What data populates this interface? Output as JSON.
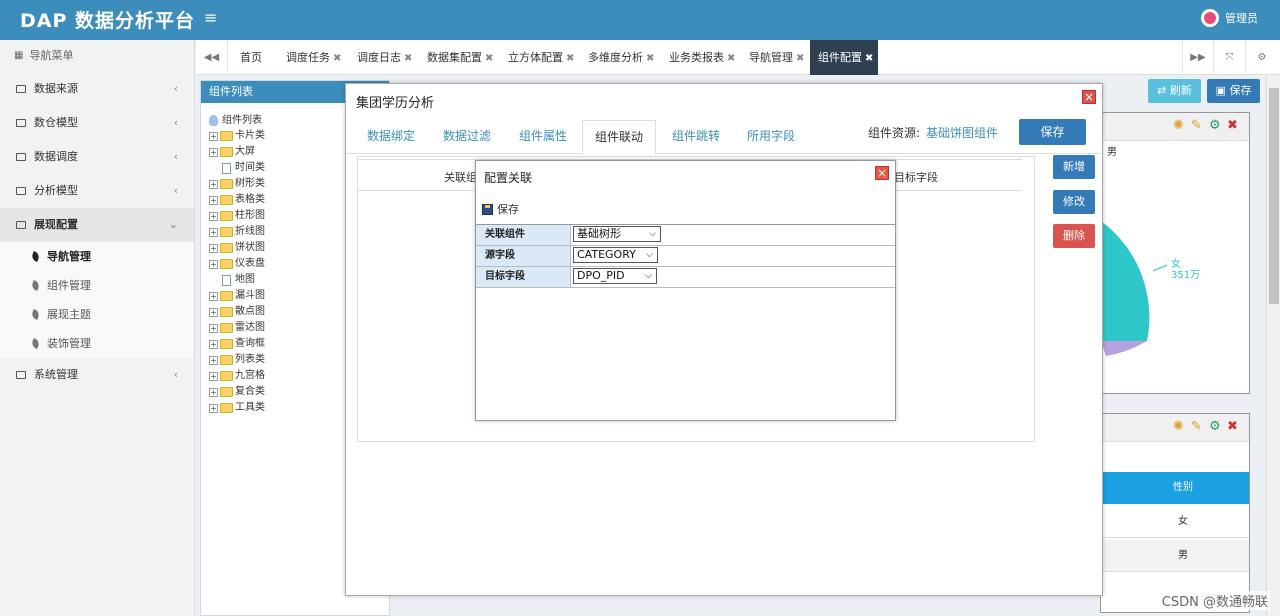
{
  "app": {
    "logo": "DAP 数据分析平台",
    "menu_toggle": "≡",
    "user": "管理员"
  },
  "sidebar": {
    "header": "导航菜单",
    "items": [
      {
        "label": "数据来源"
      },
      {
        "label": "数仓模型"
      },
      {
        "label": "数据调度"
      },
      {
        "label": "分析模型"
      },
      {
        "label": "展现配置"
      },
      {
        "label": "系统管理"
      }
    ],
    "subitems": [
      {
        "label": "导航管理"
      },
      {
        "label": "组件管理"
      },
      {
        "label": "展现主题"
      },
      {
        "label": "装饰管理"
      }
    ]
  },
  "tabs": [
    {
      "label": "首页"
    },
    {
      "label": "调度任务"
    },
    {
      "label": "调度日志"
    },
    {
      "label": "数据集配置"
    },
    {
      "label": "立方体配置"
    },
    {
      "label": "多维度分析"
    },
    {
      "label": "业务类报表"
    },
    {
      "label": "导航管理"
    },
    {
      "label": "组件配置"
    }
  ],
  "toolbar": {
    "refresh": "刷新",
    "save": "保存"
  },
  "left_panel": {
    "title": "组件列表",
    "root": "组件列表",
    "nodes": [
      {
        "label": "卡片类"
      },
      {
        "label": "大屏"
      },
      {
        "label": "时间类"
      },
      {
        "label": "树形类"
      },
      {
        "label": "表格类"
      },
      {
        "label": "柱形图"
      },
      {
        "label": "折线图"
      },
      {
        "label": "饼状图"
      },
      {
        "label": "仪表盘"
      },
      {
        "label": "地图"
      },
      {
        "label": "漏斗图"
      },
      {
        "label": "散点图"
      },
      {
        "label": "雷达图"
      },
      {
        "label": "查询框"
      },
      {
        "label": "列表类"
      },
      {
        "label": "九宫格"
      },
      {
        "label": "复合类"
      },
      {
        "label": "工具类"
      }
    ]
  },
  "dialog": {
    "title": "集团学历分析",
    "tabs": [
      {
        "label": "数据绑定"
      },
      {
        "label": "数据过滤"
      },
      {
        "label": "组件属性"
      },
      {
        "label": "组件联动"
      },
      {
        "label": "组件跳转"
      },
      {
        "label": "所用字段"
      }
    ],
    "source_label": "组件资源:",
    "source_value": "基础饼图组件",
    "save": "保存",
    "table_h1": "关联组",
    "table_h2": "目标字段",
    "side_buttons": {
      "add": "新增",
      "edit": "修改",
      "delete": "删除"
    }
  },
  "inner_dialog": {
    "title": "配置关联",
    "save": "保存",
    "fields": [
      {
        "label": "关联组件",
        "value": "基础树形"
      },
      {
        "label": "源字段",
        "value": "CATEGORY"
      },
      {
        "label": "目标字段",
        "value": "DPO_PID"
      }
    ]
  },
  "background_panels": {
    "legend_male": "男",
    "pie_label_female": "女",
    "pie_value_female": "351万",
    "table_header": "性别",
    "table_rows": [
      "女",
      "男"
    ]
  },
  "watermark": "CSDN @数通畅联",
  "colors": {
    "header": "#3c8dbc",
    "active_tab": "#2f4050",
    "refresh": "#5bc0de",
    "save": "#337ab7",
    "delete": "#d9534f",
    "pie": "#2ec7c9"
  }
}
